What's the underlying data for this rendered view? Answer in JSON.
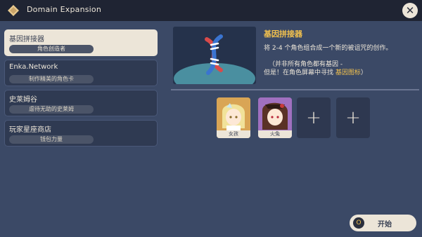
{
  "titlebar": {
    "title": "Domain Expansion"
  },
  "sidebar": {
    "items": [
      {
        "name": "基因拼接器",
        "sub": "角色创造者"
      },
      {
        "name": "Enka.Network",
        "sub": "制作精美的角色卡"
      },
      {
        "name": "史莱姆谷",
        "sub": "虐待无助的史莱姆"
      },
      {
        "name": "玩家星座商店",
        "sub": "钱包力量"
      }
    ]
  },
  "feature": {
    "title": "基因拼接器",
    "desc": "将 2-4 个角色组合成一个新的被诅咒的创作。",
    "note1": "（并非所有角色都有基因 -",
    "note2_prefix": "但是！在角色屏幕中寻找 ",
    "note2_link": "基因图标",
    "note2_suffix": "）"
  },
  "slots": [
    {
      "label": "女孩"
    },
    {
      "label": "火兔"
    },
    {
      "label": "+"
    },
    {
      "label": "+"
    }
  ],
  "start": {
    "key": "O",
    "label": "开始"
  },
  "colors": {
    "accent": "#f2c14e",
    "panel": "#3b4966",
    "active": "#ece5d8"
  }
}
